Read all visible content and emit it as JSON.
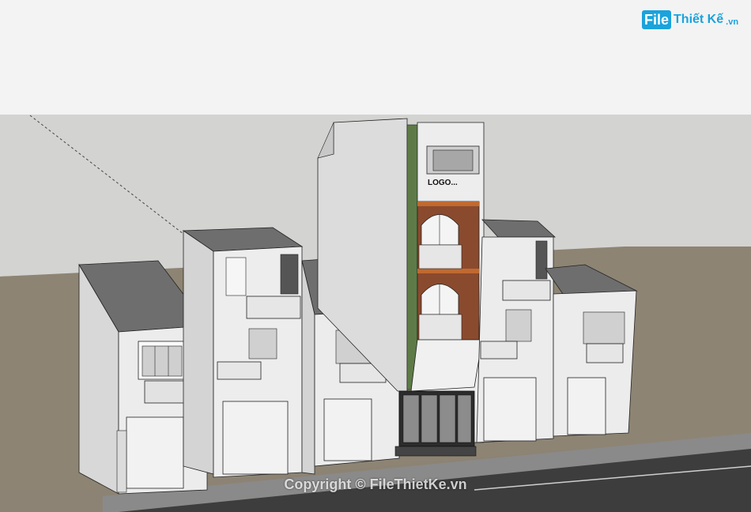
{
  "watermark": {
    "badge": "File",
    "name": "Thiết Kế",
    "suffix": ".vn"
  },
  "building_sign": "LOGO...",
  "copyright": "Copyright © FileThietKe.vn",
  "colors": {
    "sky": "#f4f4f4",
    "ground": "#8c8374",
    "wall": "#e9e9e9",
    "roof": "#6f6f6f",
    "brick": "#8a4a2e",
    "accent_wood": "#c06a30",
    "road": "#3d3d3d",
    "brand": "#1aa3dc"
  }
}
